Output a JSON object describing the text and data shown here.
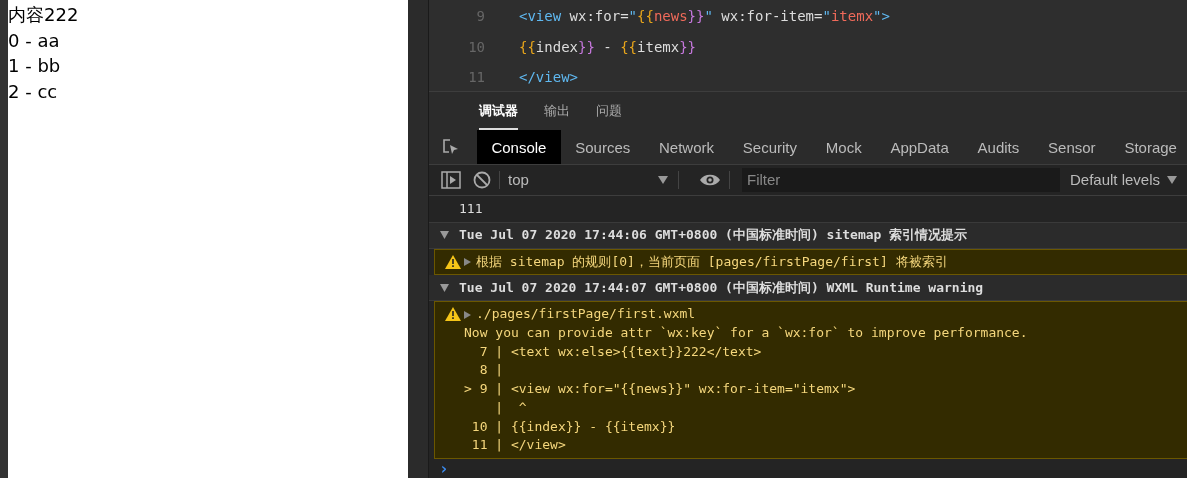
{
  "preview": {
    "lines": [
      "内容222",
      "0 - aa",
      "1 - bb",
      "2 - cc"
    ]
  },
  "editor": {
    "lines": [
      {
        "number": "9",
        "tokens": [
          {
            "kind": "tag",
            "text": "<view"
          },
          {
            "kind": "attr",
            "text": " wx:for="
          },
          {
            "kind": "tag",
            "text": "\""
          },
          {
            "kind": "brace",
            "text": "{{"
          },
          {
            "kind": "string",
            "text": "news"
          },
          {
            "kind": "brace2",
            "text": "}}"
          },
          {
            "kind": "tag",
            "text": "\""
          },
          {
            "kind": "attr",
            "text": " wx:for-item="
          },
          {
            "kind": "tag",
            "text": "\""
          },
          {
            "kind": "string",
            "text": "itemx"
          },
          {
            "kind": "tag",
            "text": "\">"
          }
        ]
      },
      {
        "number": "10",
        "tokens": [
          {
            "kind": "brace",
            "text": "{{"
          },
          {
            "kind": "attr",
            "text": "index"
          },
          {
            "kind": "brace2",
            "text": "}}"
          },
          {
            "kind": "attr",
            "text": " - "
          },
          {
            "kind": "brace",
            "text": "{{"
          },
          {
            "kind": "attr",
            "text": "itemx"
          },
          {
            "kind": "brace2",
            "text": "}}"
          }
        ]
      },
      {
        "number": "11",
        "tokens": [
          {
            "kind": "tag",
            "text": "</view>"
          }
        ]
      }
    ]
  },
  "panel_tabs": [
    {
      "label": "调试器",
      "selected": true
    },
    {
      "label": "输出",
      "selected": false
    },
    {
      "label": "问题",
      "selected": false
    }
  ],
  "devtools_tabs": [
    {
      "label": "Console",
      "selected": true
    },
    {
      "label": "Sources",
      "selected": false
    },
    {
      "label": "Network",
      "selected": false
    },
    {
      "label": "Security",
      "selected": false
    },
    {
      "label": "Mock",
      "selected": false
    },
    {
      "label": "AppData",
      "selected": false
    },
    {
      "label": "Audits",
      "selected": false
    },
    {
      "label": "Sensor",
      "selected": false
    },
    {
      "label": "Storage",
      "selected": false
    }
  ],
  "toolbar": {
    "context": "top",
    "filter": {
      "placeholder": "Filter"
    },
    "levels": "Default levels"
  },
  "console": {
    "entries": [
      {
        "kind": "log",
        "lines": [
          "111"
        ]
      },
      {
        "kind": "group",
        "expanded": true,
        "lines": [
          "Tue Jul 07 2020 17:44:06 GMT+0800 (中国标准时间) sitemap 索引情况提示"
        ]
      },
      {
        "kind": "warning",
        "expanded": false,
        "lines": [
          "根据 sitemap 的规则[0]，当前页面 [pages/firstPage/first] 将被索引"
        ]
      },
      {
        "kind": "group",
        "expanded": true,
        "lines": [
          "Tue Jul 07 2020 17:44:07 GMT+0800 (中国标准时间) WXML Runtime warning"
        ]
      },
      {
        "kind": "warning",
        "expanded": false,
        "lines": [
          "./pages/firstPage/first.wxml",
          "Now you can provide attr `wx:key` for a `wx:for` to improve performance.",
          "  7 | <text wx:else>{{text}}222</text>",
          "  8 |",
          "> 9 | <view wx:for=\"{{news}}\" wx:for-item=\"itemx\">",
          "    |  ^",
          " 10 | {{index}} - {{itemx}}",
          " 11 | </view>"
        ]
      }
    ],
    "prompt": "›"
  }
}
